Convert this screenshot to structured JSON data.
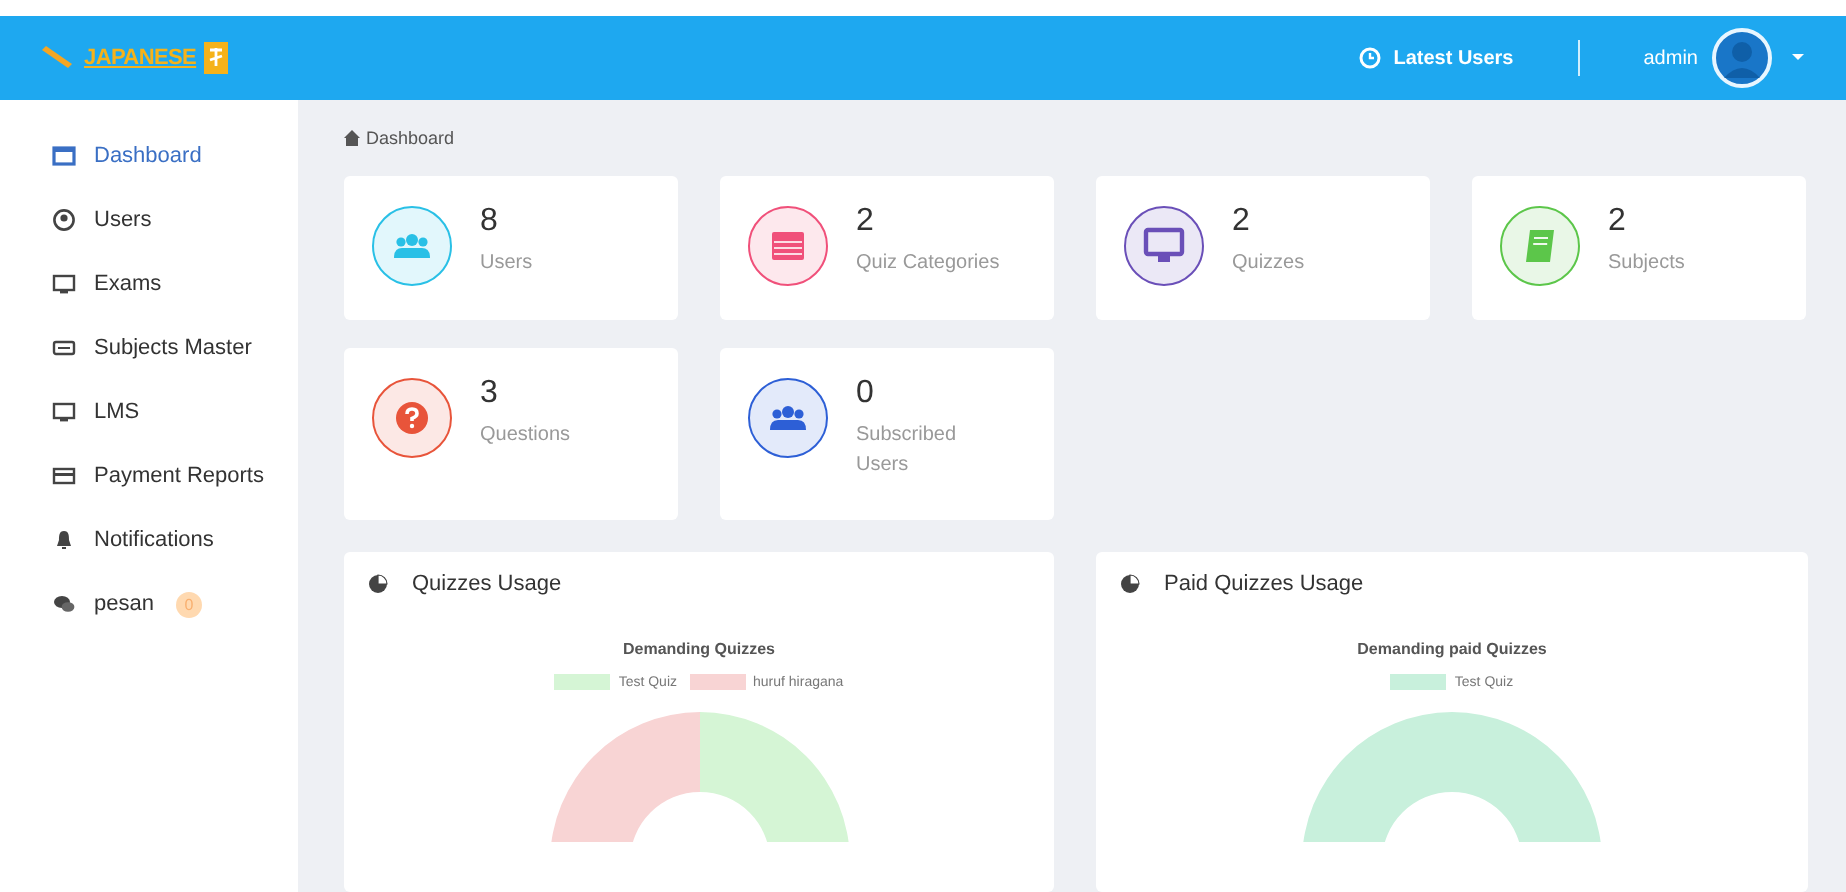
{
  "header": {
    "logo_text": "JAPANESE",
    "latest_users": "Latest Users",
    "user": "admin"
  },
  "sidebar": {
    "items": [
      {
        "label": "Dashboard",
        "kind": "window",
        "selected": true
      },
      {
        "label": "Users",
        "kind": "user",
        "selected": false
      },
      {
        "label": "Exams",
        "kind": "monitor",
        "selected": false
      },
      {
        "label": "Subjects Master",
        "kind": "ticket",
        "selected": false
      },
      {
        "label": "LMS",
        "kind": "monitor",
        "selected": false
      },
      {
        "label": "Payment Reports",
        "kind": "card",
        "selected": false
      },
      {
        "label": "Notifications",
        "kind": "bell",
        "selected": false
      },
      {
        "label": "pesan",
        "kind": "chat",
        "selected": false,
        "badge": "0"
      }
    ]
  },
  "breadcrumb": "Dashboard",
  "stats": [
    {
      "value": "8",
      "label": "Users",
      "kind": "users",
      "color": "#29c0e6"
    },
    {
      "value": "2",
      "label": "Quiz Categories",
      "kind": "calendar",
      "color": "#f0507a"
    },
    {
      "value": "2",
      "label": "Quizzes",
      "kind": "monitor",
      "color": "#6a4fb8"
    },
    {
      "value": "2",
      "label": "Subjects",
      "kind": "book",
      "color": "#5cc64a"
    },
    {
      "value": "3",
      "label": "Questions",
      "kind": "question",
      "color": "#e8543a"
    },
    {
      "value": "0",
      "label": "Subscribed Users",
      "kind": "users",
      "color": "#2d5fd6"
    }
  ],
  "panels": [
    {
      "title": "Quizzes Usage",
      "chart_title": "Demanding Quizzes",
      "legend": [
        {
          "label": "Test Quiz",
          "color": "#d5f5d5"
        },
        {
          "label": "huruf hiragana",
          "color": "#f8d4d4"
        }
      ]
    },
    {
      "title": "Paid Quizzes Usage",
      "chart_title": "Demanding paid Quizzes",
      "legend": [
        {
          "label": "Test Quiz",
          "color": "#c8f0dc"
        }
      ]
    }
  ]
}
